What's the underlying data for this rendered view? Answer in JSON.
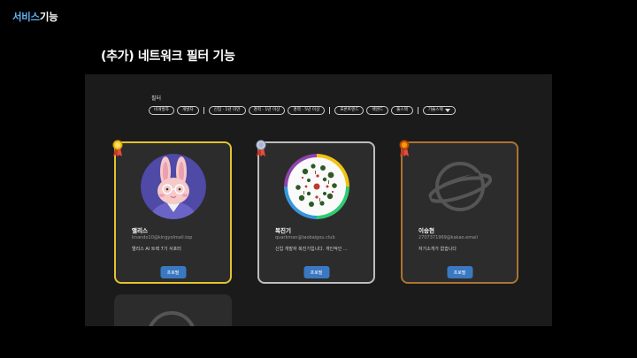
{
  "header": {
    "brand_part1": "서비스",
    "brand_part2": "기능"
  },
  "slide": {
    "title": "(추가) 네트워크 필터 기능"
  },
  "filter": {
    "label": "필터",
    "chips": [
      "비개발자",
      "개발자",
      "신입 · 1년 미만",
      "경력 · 1년 이상",
      "경력 · 5년 이상",
      "프론트엔드",
      "백엔드",
      "풀스택",
      "기술스택"
    ]
  },
  "cards": [
    {
      "name": "앨리스",
      "email": "knando10@kingyolmail.top",
      "bio": "앨리스 AI 트랙 7기 서포터",
      "button": "프로필",
      "medal": "gold"
    },
    {
      "name": "복진기",
      "email": "quarkman@taobaigou.club",
      "bio": "신입 개발자 복진기입니다. 개인적인 ...",
      "button": "프로필",
      "medal": "silver"
    },
    {
      "name": "이승현",
      "email": "2707371969@kakao.email",
      "bio": "자기소개가 없습니다",
      "button": "프로필",
      "medal": "bronze"
    }
  ],
  "colors": {
    "accent": "#3a78c2",
    "gold": "#e4c22d",
    "silver": "#bdbdbd",
    "bronze": "#ad7332",
    "brand": "#5fb2f0"
  },
  "icons": {
    "card1_avatar": "rabbit-avatar",
    "card2_avatar": "plant-illustration-avatar",
    "card3_avatar": "planet-placeholder-icon"
  }
}
